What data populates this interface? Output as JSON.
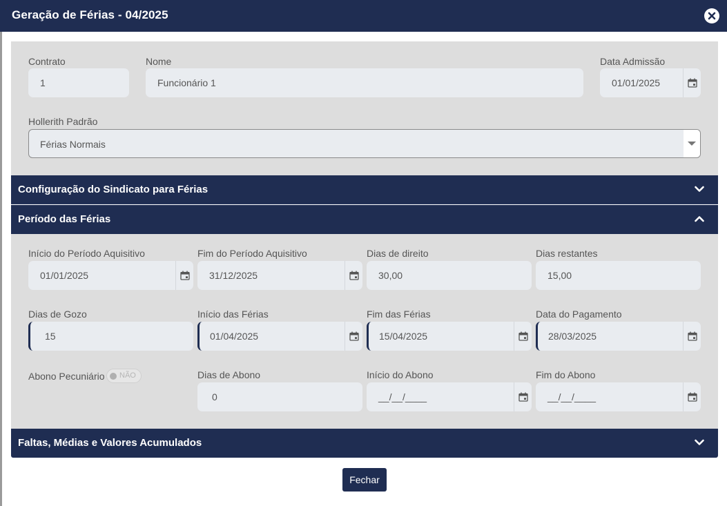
{
  "modal": {
    "title": "Geração de Férias - 04/2025",
    "close_icon": "close-icon"
  },
  "top": {
    "contrato": {
      "label": "Contrato",
      "value": "1"
    },
    "nome": {
      "label": "Nome",
      "value": "Funcionário 1"
    },
    "data_admissao": {
      "label": "Data Admissão",
      "value": "01/01/2025"
    },
    "hollerith": {
      "label": "Hollerith Padrão",
      "value": "Férias Normais"
    }
  },
  "sections": {
    "sindicato": {
      "title": "Configuração do Sindicato para Férias",
      "expanded": false
    },
    "periodo": {
      "title": "Período das Férias",
      "expanded": true
    },
    "faltas": {
      "title": "Faltas, Médias e Valores Acumulados",
      "expanded": false
    }
  },
  "periodo": {
    "inicio_aquisitivo": {
      "label": "Início do Período Aquisitivo",
      "value": "01/01/2025"
    },
    "fim_aquisitivo": {
      "label": "Fim do Período Aquisitivo",
      "value": "31/12/2025"
    },
    "dias_direito": {
      "label": "Dias de direito",
      "value": "30,00"
    },
    "dias_restantes": {
      "label": "Dias restantes",
      "value": "15,00"
    },
    "dias_gozo": {
      "label": "Dias de Gozo",
      "value": "15"
    },
    "inicio_ferias": {
      "label": "Início das Férias",
      "value": "01/04/2025"
    },
    "fim_ferias": {
      "label": "Fim das Férias",
      "value": "15/04/2025"
    },
    "data_pagamento": {
      "label": "Data do Pagamento",
      "value": "28/03/2025"
    },
    "abono_pecuniario": {
      "label": "Abono Pecuniário",
      "toggle_text": "NÃO",
      "on": false
    },
    "dias_abono": {
      "label": "Dias de Abono",
      "value": "0"
    },
    "inicio_abono": {
      "label": "Início do Abono",
      "value": "__/__/____"
    },
    "fim_abono": {
      "label": "Fim do Abono",
      "value": "__/__/____"
    }
  },
  "footer": {
    "fechar_label": "Fechar"
  },
  "colors": {
    "header": "#1f2d52",
    "panel": "#dddddd",
    "field": "#e9ecf0"
  }
}
